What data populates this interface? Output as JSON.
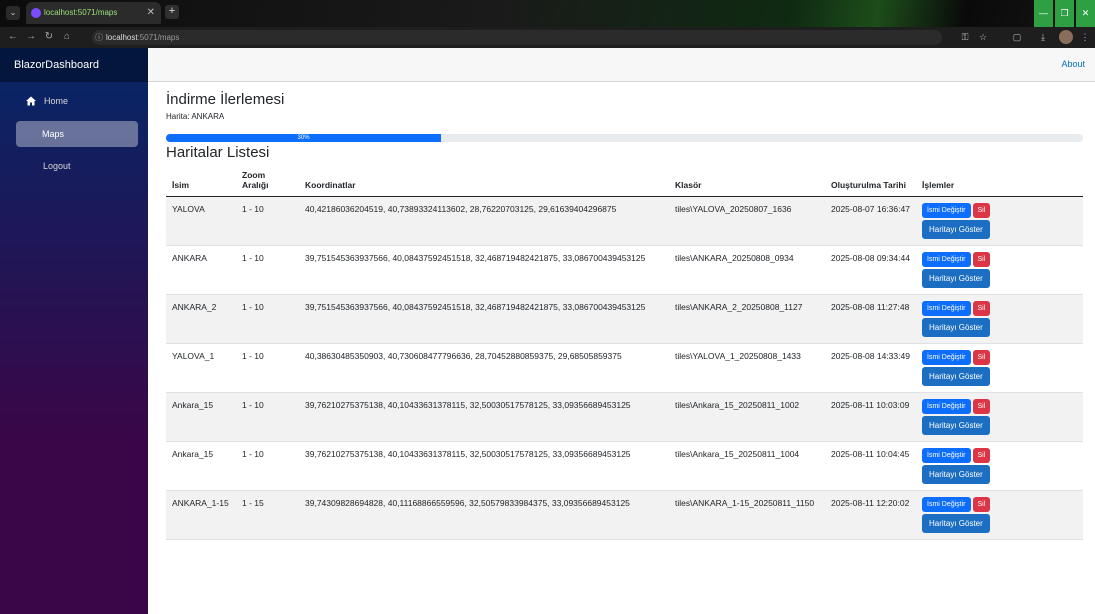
{
  "browser": {
    "tab_title": "localhost:5071/maps",
    "url_host": "localhost",
    "url_path": ":5071/maps"
  },
  "sidebar": {
    "brand": "BlazorDashboard",
    "items": [
      {
        "label": "Home"
      },
      {
        "label": "Maps"
      },
      {
        "label": "Logout"
      }
    ]
  },
  "topbar": {
    "about": "About"
  },
  "download": {
    "heading": "İndirme İlerlemesi",
    "map_label": "Harita: ANKARA",
    "progress_label": "30%",
    "progress_value": 30
  },
  "maps": {
    "heading": "Haritalar Listesi",
    "columns": [
      "İsim",
      "Zoom Aralığı",
      "Koordinatlar",
      "Klasör",
      "Oluşturulma Tarihi",
      "İşlemler"
    ],
    "actions": {
      "rename": "İsmi Değiştir",
      "delete": "Sil",
      "show": "Haritayı Göster"
    },
    "rows": [
      {
        "name": "YALOVA",
        "zoom": "1 - 10",
        "coords": "40,42186036204519, 40,73893324113602, 28,76220703125, 29,61639404296875",
        "folder": "tiles\\YALOVA_20250807_1636",
        "created": "2025-08-07 16:36:47"
      },
      {
        "name": "ANKARA",
        "zoom": "1 - 10",
        "coords": "39,751545363937566, 40,08437592451518, 32,468719482421875, 33,086700439453125",
        "folder": "tiles\\ANKARA_20250808_0934",
        "created": "2025-08-08 09:34:44"
      },
      {
        "name": "ANKARA_2",
        "zoom": "1 - 10",
        "coords": "39,751545363937566, 40,08437592451518, 32,468719482421875, 33,086700439453125",
        "folder": "tiles\\ANKARA_2_20250808_1127",
        "created": "2025-08-08 11:27:48"
      },
      {
        "name": "YALOVA_1",
        "zoom": "1 - 10",
        "coords": "40,38630485350903, 40,730608477796636, 28,70452880859375, 29,68505859375",
        "folder": "tiles\\YALOVA_1_20250808_1433",
        "created": "2025-08-08 14:33:49"
      },
      {
        "name": "Ankara_15",
        "zoom": "1 - 10",
        "coords": "39,76210275375138, 40,10433631378115, 32,50030517578125, 33,09356689453125",
        "folder": "tiles\\Ankara_15_20250811_1002",
        "created": "2025-08-11 10:03:09"
      },
      {
        "name": "Ankara_15",
        "zoom": "1 - 10",
        "coords": "39,76210275375138, 40,10433631378115, 32,50030517578125, 33,09356689453125",
        "folder": "tiles\\Ankara_15_20250811_1004",
        "created": "2025-08-11 10:04:45"
      },
      {
        "name": "ANKARA_1-15",
        "zoom": "1 - 15",
        "coords": "39,74309828694828, 40,11168866559596, 32,50579833984375, 33,09356689453125",
        "folder": "tiles\\ANKARA_1-15_20250811_1150",
        "created": "2025-08-11 12:20:02"
      }
    ]
  },
  "colors": {
    "primary": "#0d6efd",
    "danger": "#dc3545",
    "show_button": "#1b6ec2",
    "sidebar_top": "#052767",
    "sidebar_bottom": "#3a0647"
  }
}
